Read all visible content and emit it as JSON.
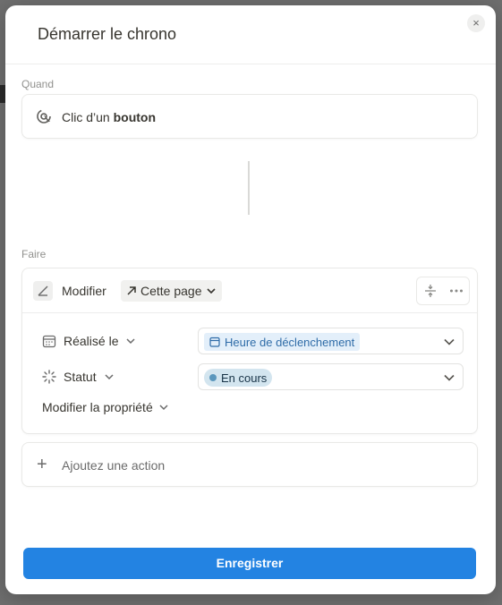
{
  "modal": {
    "title": "Démarrer le chrono",
    "close_label": "×"
  },
  "trigger": {
    "section_label": "Quand",
    "prefix": "Clic d’un",
    "emphasis": "bouton"
  },
  "action": {
    "section_label": "Faire",
    "verb": "Modifier",
    "target": "Cette page",
    "properties": [
      {
        "name": "Réalisé le",
        "value": "Heure de déclenchement"
      },
      {
        "name": "Statut",
        "value": "En cours"
      }
    ],
    "modify_property_label": "Modifier la propriété"
  },
  "add_action_label": "Ajoutez une action",
  "save_label": "Enregistrer",
  "colors": {
    "primary": "#2383e2",
    "status_chip": "#d3e5ef",
    "date_chip": "#e3effa"
  }
}
